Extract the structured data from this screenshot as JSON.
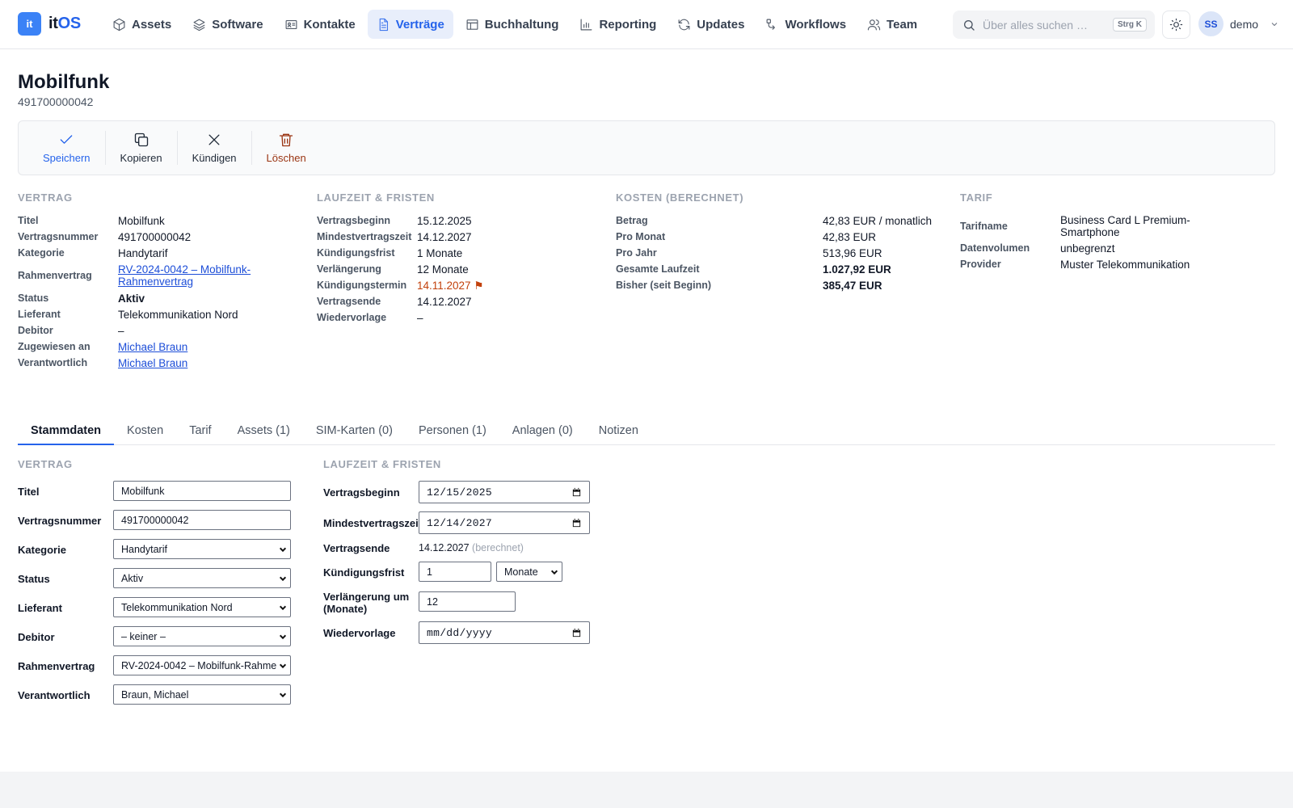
{
  "app": {
    "logo_badge": "it",
    "logo_prefix": "it",
    "logo_suffix": "OS"
  },
  "nav": [
    {
      "label": "Assets",
      "icon": "box-icon"
    },
    {
      "label": "Software",
      "icon": "layers-icon"
    },
    {
      "label": "Kontakte",
      "icon": "contact-card-icon"
    },
    {
      "label": "Verträge",
      "icon": "document-icon",
      "active": true
    },
    {
      "label": "Buchhaltung",
      "icon": "ledger-icon"
    },
    {
      "label": "Reporting",
      "icon": "bar-chart-icon"
    },
    {
      "label": "Updates",
      "icon": "refresh-icon"
    },
    {
      "label": "Workflows",
      "icon": "workflow-icon"
    },
    {
      "label": "Team",
      "icon": "users-icon"
    }
  ],
  "search": {
    "placeholder": "Über alles suchen …",
    "shortcut": "Strg K"
  },
  "user": {
    "initials": "SS",
    "name": "demo"
  },
  "page": {
    "title": "Mobilfunk",
    "subtitle": "491700000042"
  },
  "toolbar": {
    "save": "Speichern",
    "copy": "Kopieren",
    "cancel": "Kündigen",
    "delete": "Löschen"
  },
  "summary": {
    "vertrag": {
      "heading": "VERTRAG",
      "rows": [
        {
          "label": "Titel",
          "value": "Mobilfunk"
        },
        {
          "label": "Vertragsnummer",
          "value": "491700000042"
        },
        {
          "label": "Kategorie",
          "value": "Handytarif"
        },
        {
          "label": "Rahmenvertrag",
          "value": "RV-2024-0042 – Mobilfunk-Rahmenvertrag"
        },
        {
          "label": "Status",
          "value": "Aktiv"
        },
        {
          "label": "Lieferant",
          "value": "Telekommunikation Nord"
        },
        {
          "label": "Debitor",
          "value": "–"
        },
        {
          "label": "Zugewiesen an",
          "value": "Michael Braun"
        },
        {
          "label": "Verantwortlich",
          "value": "Michael Braun"
        }
      ]
    },
    "laufzeit": {
      "heading": "LAUFZEIT & FRISTEN",
      "rows": [
        {
          "label": "Vertragsbeginn",
          "value": "15.12.2025"
        },
        {
          "label": "Mindestvertragszeit",
          "value": "14.12.2027"
        },
        {
          "label": "Kündigungsfrist",
          "value": "1 Monate"
        },
        {
          "label": "Verlängerung",
          "value": "12 Monate"
        },
        {
          "label": "Kündigungstermin",
          "value": "14.11.2027",
          "flag": "⚑"
        },
        {
          "label": "Vertragsende",
          "value": "14.12.2027"
        },
        {
          "label": "Wiedervorlage",
          "value": "–"
        }
      ]
    },
    "kosten": {
      "heading": "KOSTEN (BERECHNET)",
      "rows": [
        {
          "label": "Betrag",
          "value": "42,83 EUR / monatlich"
        },
        {
          "label": "Pro Monat",
          "value": "42,83 EUR"
        },
        {
          "label": "Pro Jahr",
          "value": "513,96 EUR"
        },
        {
          "label": "Gesamte Laufzeit",
          "value": "1.027,92 EUR"
        },
        {
          "label": "Bisher (seit Beginn)",
          "value": "385,47 EUR"
        }
      ]
    },
    "tarif": {
      "heading": "TARIF",
      "rows": [
        {
          "label": "Tarifname",
          "value": "Business Card L Premium-Smartphone"
        },
        {
          "label": "Datenvolumen",
          "value": "unbegrenzt"
        },
        {
          "label": "Provider",
          "value": "Muster Telekommunikation"
        }
      ]
    }
  },
  "tabs": [
    "Stammdaten",
    "Kosten",
    "Tarif",
    "Assets (1)",
    "SIM-Karten (0)",
    "Personen (1)",
    "Anlagen (0)",
    "Notizen"
  ],
  "form": {
    "vertrag": {
      "heading": "VERTRAG",
      "titel": {
        "label": "Titel",
        "value": "Mobilfunk"
      },
      "vertragsnummer": {
        "label": "Vertragsnummer",
        "value": "491700000042"
      },
      "kategorie": {
        "label": "Kategorie",
        "value": "Handytarif"
      },
      "status": {
        "label": "Status",
        "value": "Aktiv"
      },
      "lieferant": {
        "label": "Lieferant",
        "value": "Telekommunikation Nord"
      },
      "debitor": {
        "label": "Debitor",
        "value": "– keiner –"
      },
      "rahmenvertrag": {
        "label": "Rahmenvertrag",
        "value": "RV-2024-0042 – Mobilfunk-Rahme"
      },
      "verantwortlich": {
        "label": "Verantwortlich",
        "value": "Braun, Michael"
      }
    },
    "laufzeit": {
      "heading": "LAUFZEIT & FRISTEN",
      "beginn": {
        "label": "Vertragsbeginn",
        "value": "12/15/2025"
      },
      "mindest": {
        "label": "Mindestvertragszeit",
        "value": "12/14/2027"
      },
      "ende": {
        "label": "Vertragsende",
        "value": "14.12.2027",
        "note": "(berechnet)"
      },
      "frist": {
        "label": "Kündigungsfrist",
        "value": "1",
        "unit": "Monate"
      },
      "verlaengerung": {
        "label": "Verlängerung um (Monate)",
        "value": "12"
      },
      "wiedervorlage": {
        "label": "Wiedervorlage",
        "placeholder": "mm/dd/yyyy"
      }
    }
  },
  "colors": {
    "accent": "#2563eb",
    "warning": "#c2410c",
    "delete": "#9a3412",
    "logo": "#3b82f6"
  }
}
